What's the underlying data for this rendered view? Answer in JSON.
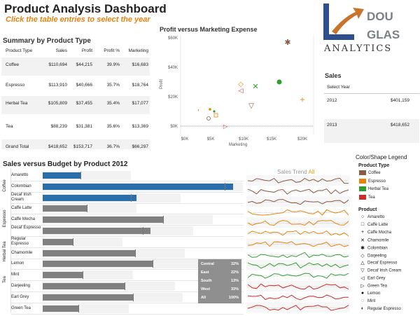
{
  "header": {
    "title": "Product Analysis Dashboard",
    "subtitle": "Click the table entries to select the year"
  },
  "logo": {
    "letters_top": "DOU",
    "letters_mid": "GLAS",
    "word": "ANALYTICS",
    "colors": {
      "l_shape": "#2e4f8e",
      "arrow": "#c8742a"
    }
  },
  "summary": {
    "title": "Summary by Product Type",
    "columns": [
      "Product Type",
      "Sales",
      "Profit",
      "Profit %",
      "Marketing"
    ],
    "rows": [
      [
        "Coffee",
        "$110,694",
        "$44,215",
        "39.9%",
        "$16,683"
      ],
      [
        "Espresso",
        "$113,910",
        "$40,666",
        "35.7%",
        "$18,764"
      ],
      [
        "Herbal Tea",
        "$105,809",
        "$37,455",
        "35.4%",
        "$17,077"
      ],
      [
        "Tea",
        "$88,239",
        "$31,381",
        "35.6%",
        "$13,369"
      ],
      [
        "Grand Total",
        "$418,652",
        "$153,717",
        "36.7%",
        "$66,297"
      ]
    ]
  },
  "scatter": {
    "title": "Profit versus Marketing Expense",
    "y_ticks": [
      "$60K",
      "$40K",
      "$20K",
      "$0K"
    ],
    "x_ticks": [
      "$0K",
      "$5K",
      "$10K",
      "$15K",
      "$20K"
    ],
    "ylabel": "Profit",
    "xlabel": "Marketing"
  },
  "sales": {
    "title": "Sales",
    "header": "Select Year",
    "rows": [
      {
        "year": "2012",
        "value": "$401,159"
      },
      {
        "year": "2013",
        "value": "$418,652"
      }
    ]
  },
  "bars": {
    "title": "Sales versus Budget by Product 2012",
    "categories": [
      {
        "name": "Coffee",
        "rows": [
          0,
          2
        ]
      },
      {
        "name": "Espresso",
        "rows": [
          3,
          5
        ]
      },
      {
        "name": "Herbal Tea",
        "rows": [
          6,
          8
        ]
      },
      {
        "name": "Tea",
        "rows": [
          9,
          10
        ]
      }
    ],
    "products": [
      {
        "label": "Amaretto",
        "value": 0.19,
        "budget": 0.19,
        "color": "#2a6ead"
      },
      {
        "label": "Colombian",
        "value": 0.95,
        "budget": 0.91,
        "color": "#2a6ead"
      },
      {
        "label": "Decaf Irish Cream",
        "value": 0.47,
        "budget": 0.44,
        "color": "#2a6ead"
      },
      {
        "label": "Caffe Latte",
        "value": 0.22,
        "budget": 0.22,
        "color": "#808080"
      },
      {
        "label": "Caffe Mocha",
        "value": 0.6,
        "budget": 0.6,
        "color": "#808080"
      },
      {
        "label": "Decaf Espresso",
        "value": 0.54,
        "budget": 0.5,
        "color": "#808080"
      },
      {
        "label": "Regular Espresso",
        "value": 0.15,
        "budget": 0.15,
        "color": "#808080"
      },
      {
        "label": "Chamomile",
        "value": 0.46,
        "budget": 0.46,
        "color": "#808080"
      },
      {
        "label": "Lemon",
        "value": 0.55,
        "budget": 0.55,
        "color": "#808080"
      },
      {
        "label": "Mint",
        "value": 0.2,
        "budget": 0.2,
        "color": "#808080"
      },
      {
        "label": "Darjeeling",
        "value": 0.41,
        "budget": 0.41,
        "color": "#808080"
      },
      {
        "label": "Earl Grey",
        "value": 0.45,
        "budget": 0.45,
        "color": "#808080"
      },
      {
        "label": "Green Tea",
        "value": 0.18,
        "budget": 0.18,
        "color": "#808080"
      }
    ],
    "regions": [
      {
        "name": "Central",
        "pct": "32%"
      },
      {
        "name": "East",
        "pct": "22%"
      },
      {
        "name": "South",
        "pct": "13%"
      },
      {
        "name": "West",
        "pct": "33%"
      },
      {
        "name": "All",
        "pct": "100%"
      }
    ]
  },
  "trend": {
    "title": "Sales Trend",
    "all_label": "All"
  },
  "legend": {
    "title": "Color/Shape Legend",
    "type_title": "Product Type",
    "types": [
      {
        "label": "Coffee",
        "color": "#8a5a44"
      },
      {
        "label": "Espresso",
        "color": "#e8820c"
      },
      {
        "label": "Herbal Tea",
        "color": "#2f9e2f"
      },
      {
        "label": "Tea",
        "color": "#cc2b2b"
      }
    ],
    "product_title": "Product",
    "products": [
      {
        "label": "Amaretto",
        "shape": "○"
      },
      {
        "label": "Caffe Latte",
        "shape": "□"
      },
      {
        "label": "Caffe Mocha",
        "shape": "+"
      },
      {
        "label": "Chamomile",
        "shape": "✕"
      },
      {
        "label": "Colombian",
        "shape": "✱"
      },
      {
        "label": "Darjeeling",
        "shape": "◇"
      },
      {
        "label": "Decaf Espresso",
        "shape": "△"
      },
      {
        "label": "Decaf Irish Cream",
        "shape": "▽"
      },
      {
        "label": "Earl Grey",
        "shape": "◁"
      },
      {
        "label": "Green Tea",
        "shape": "▷"
      },
      {
        "label": "Lemon",
        "shape": "●"
      },
      {
        "label": "Mint",
        "shape": "◌"
      },
      {
        "label": "Regular Espresso",
        "shape": "◐"
      }
    ]
  }
}
